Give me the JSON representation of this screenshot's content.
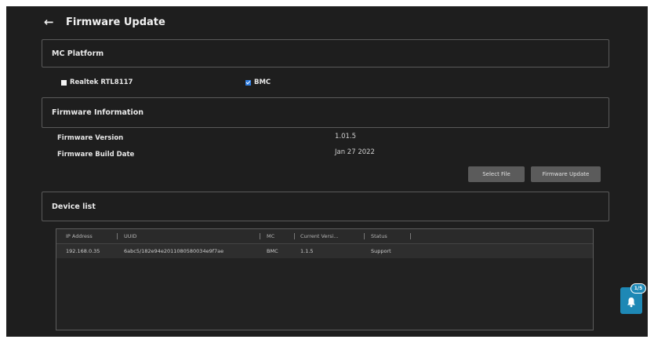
{
  "header": {
    "title": "Firmware Update",
    "back_icon": "arrow-left-icon"
  },
  "mc_platform": {
    "title": "MC Platform",
    "options": [
      {
        "label": "Realtek RTL8117",
        "checked": false
      },
      {
        "label": "BMC",
        "checked": true
      }
    ]
  },
  "firmware_info": {
    "title": "Firmware Information",
    "version_label": "Firmware Version",
    "version_value": "1.01.5",
    "build_date_label": "Firmware Build Date",
    "build_date_value": "Jan 27 2022"
  },
  "buttons": {
    "select_file": "Select File",
    "firmware_update": "Firmware Update"
  },
  "device_list": {
    "title": "Device list",
    "columns": [
      "IP Address",
      "UUID",
      "MC",
      "Current Versi...",
      "Status"
    ],
    "rows": [
      [
        "192.168.0.35",
        "6abc5/182e94e2011080580034e9f7ae",
        "BMC",
        "1.1.5",
        "Support"
      ]
    ]
  },
  "notification": {
    "icon": "bell-icon",
    "badge": "1/5"
  },
  "colors": {
    "background": "#1e1e1e",
    "checkbox_checked": "#2f7de1",
    "button": "#5b5b5b",
    "notification": "#1e88b5"
  }
}
